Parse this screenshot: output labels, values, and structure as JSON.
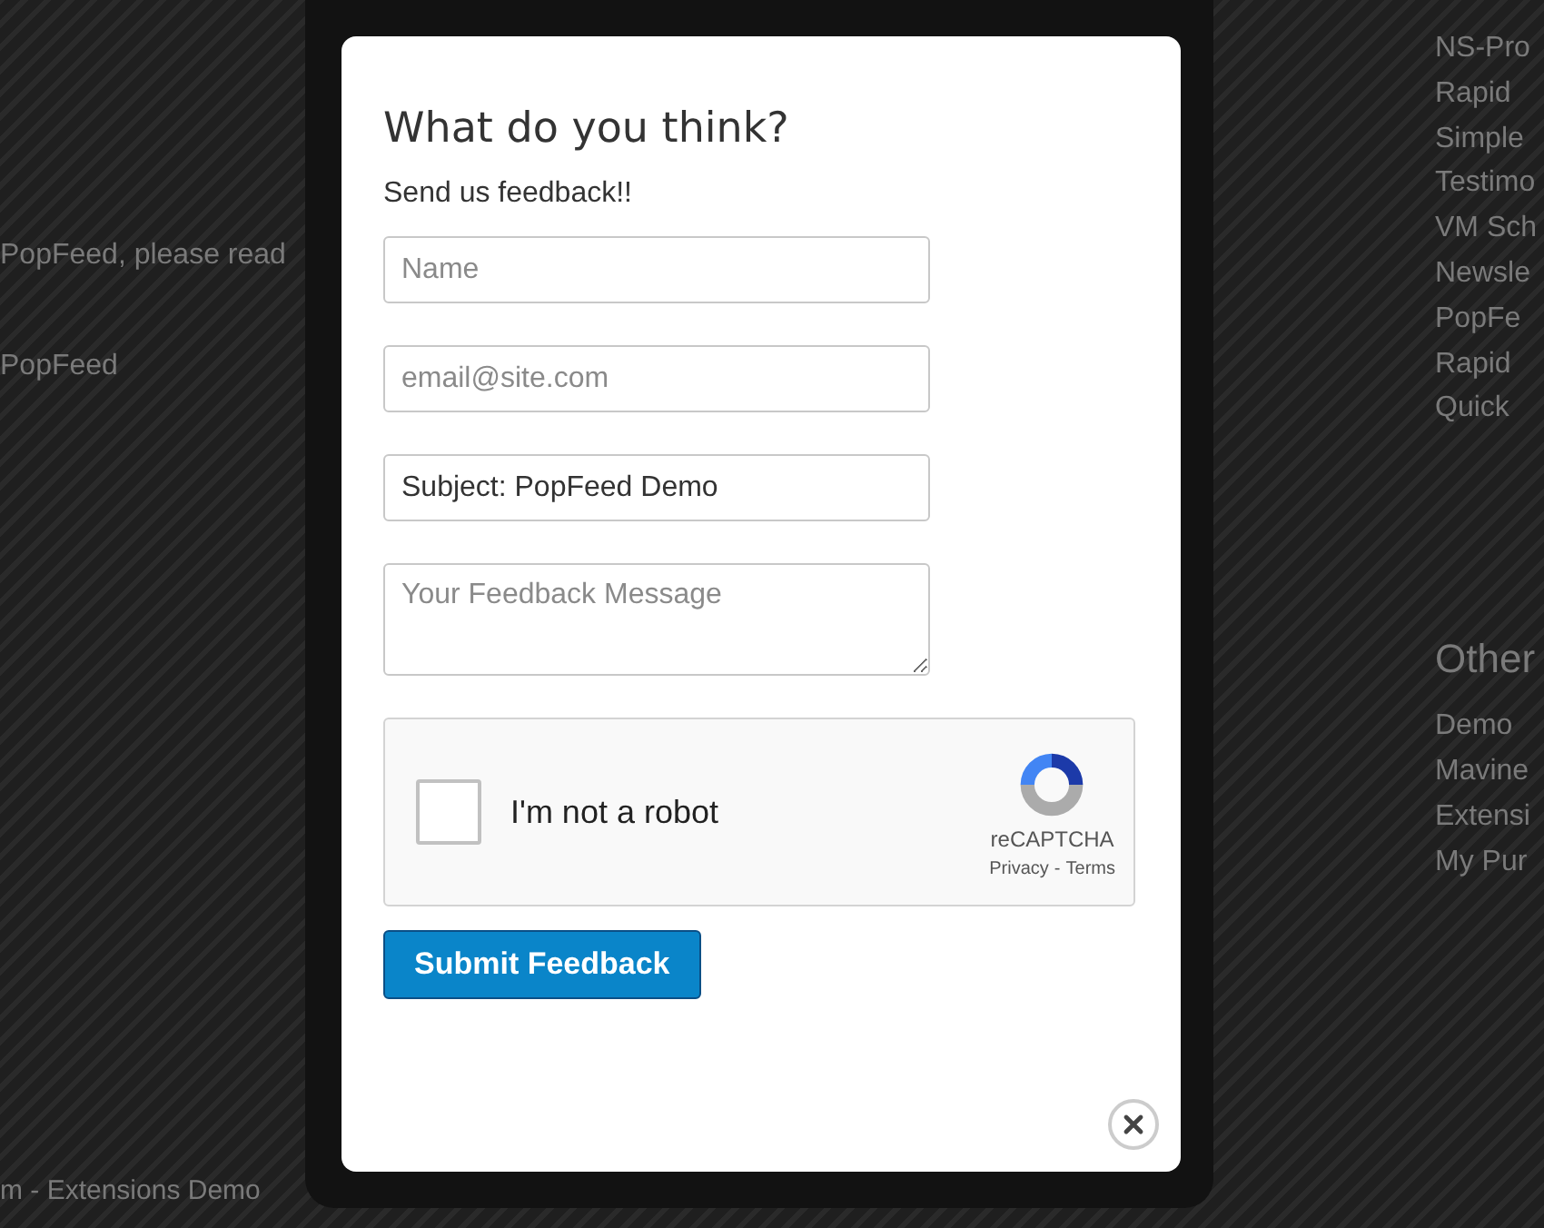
{
  "background": {
    "left_texts": [
      "PopFeed, please read",
      "PopFeed"
    ],
    "footer_text": "m - Extensions Demo",
    "sidebar_links": [
      "NS-Pro",
      "Rapid",
      "Simple",
      "Testimo",
      "VM Sch",
      "Newsle",
      "PopFe",
      "Rapid",
      "Quick"
    ],
    "sidebar_heading": "Other",
    "sidebar_links_2": [
      "Demo",
      "Mavine",
      "Extensi",
      "My Pur"
    ]
  },
  "modal": {
    "title": "What do you think?",
    "subtitle": "Send us feedback!!",
    "fields": [
      {
        "kind": "input",
        "placeholder": "Name"
      },
      {
        "kind": "input",
        "placeholder": "email@site.com"
      },
      {
        "kind": "input",
        "value": "Subject: PopFeed Demo"
      },
      {
        "kind": "textarea",
        "placeholder": "Your Feedback Message"
      }
    ],
    "captcha": {
      "checked": false,
      "label": "I'm not a robot",
      "brand": "reCAPTCHA",
      "links": [
        "Privacy",
        "Terms"
      ],
      "separator": "-"
    },
    "submit": "Submit Feedback"
  }
}
